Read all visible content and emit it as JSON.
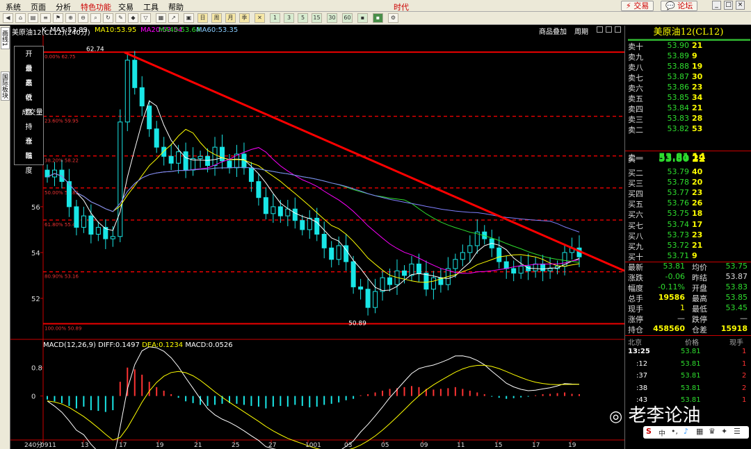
{
  "menubar": {
    "items": [
      "系统",
      "页面",
      "分析",
      "特色功能",
      "交易",
      "工具",
      "帮助"
    ],
    "title": "时代",
    "trade_button": "交易",
    "forum_button": "论坛"
  },
  "toolbar": {
    "periods": [
      "1",
      "3",
      "5",
      "15",
      "30",
      "60"
    ]
  },
  "leftrail": {
    "tab1": "画线1",
    "tab2": "国际板块"
  },
  "chart_header": {
    "instrument": "美原油12(CL12)(240分)",
    "k": "K",
    "ma5": "MA5:53.89",
    "ma10": "MA10:53.95",
    "ma20": "MA20:53.54",
    "ma40": "MA40:53.64",
    "ma60": "MA60:53.35",
    "link1": "商品叠加",
    "link2": "周期"
  },
  "pricebox": [
    {
      "a": "开",
      "b": "盘"
    },
    {
      "a": "最",
      "b": "高"
    },
    {
      "a": "最",
      "b": "低"
    },
    {
      "a": "收",
      "b": "盘"
    },
    {
      "a": "成交",
      "b": "量"
    },
    {
      "a": "持",
      "b": "仓"
    },
    {
      "a": "涨",
      "b": "跌"
    },
    {
      "a": "幅",
      "b": "度"
    }
  ],
  "chart_data": {
    "type": "candlestick",
    "timeframe": "240分",
    "ylim": [
      50.3,
      63.3
    ],
    "y_ticks": [
      52,
      54,
      56
    ],
    "x_ticks": [
      "0911",
      "13",
      "17",
      "19",
      "21",
      "25",
      "27",
      "1001",
      "03",
      "05",
      "09",
      "11",
      "15",
      "17",
      "19"
    ],
    "peak_label": "62.74",
    "low_label": "50.89",
    "fib_levels": [
      {
        "label": "0.00% 62.75",
        "value": 62.75
      },
      {
        "label": "23.60% 59.95",
        "value": 59.95
      },
      {
        "label": "38.20% 58.22",
        "value": 58.22
      },
      {
        "label": "50.00% 56.82",
        "value": 56.82
      },
      {
        "label": "61.80% 55.42",
        "value": 55.42
      },
      {
        "label": "80.90% 53.16",
        "value": 53.16
      },
      {
        "label": "100.00% 50.89",
        "value": 50.89
      }
    ],
    "trendline": {
      "from": [
        0.14,
        62.74
      ],
      "to": [
        1.0,
        53.2
      ]
    },
    "closes": [
      57.3,
      57.6,
      57.1,
      56.0,
      55.1,
      55.6,
      54.8,
      55.1,
      54.6,
      54.7,
      59.7,
      62.4,
      61.2,
      60.4,
      59.4,
      58.6,
      58.2,
      57.9,
      58.4,
      57.6,
      58.1,
      58.2,
      57.8,
      58.6,
      58.0,
      57.7,
      58.3,
      57.7,
      57.1,
      56.4,
      55.7,
      56.0,
      55.6,
      55.9,
      55.4,
      55.0,
      55.5,
      54.8,
      54.2,
      53.7,
      54.3,
      53.6,
      52.5,
      52.4,
      51.6,
      52.3,
      52.9,
      52.6,
      53.2,
      53.0,
      53.5,
      53.1,
      52.4,
      52.9,
      52.6,
      53.3,
      53.7,
      54.0,
      54.3,
      54.9,
      54.6,
      54.2,
      53.6,
      53.3,
      53.1,
      53.4,
      53.2,
      53.5,
      53.2,
      53.3,
      53.4,
      54.0,
      54.2,
      53.81
    ],
    "macd": {
      "label": "MACD(12,26,9)",
      "diff": "DIFF:0.1497",
      "dea": "DEA:0.1234",
      "macd": "MACD:0.0526",
      "ylim": [
        -1.2,
        1.4
      ],
      "y_ticks": [
        0,
        0.8
      ],
      "hist": [
        -0.1,
        -0.15,
        -0.2,
        -0.28,
        -0.35,
        -0.3,
        -0.4,
        -0.42,
        -0.45,
        -0.4,
        0.4,
        0.8,
        0.75,
        0.6,
        0.4,
        0.25,
        0.15,
        0.05,
        -0.05,
        -0.15,
        -0.2,
        -0.25,
        -0.28,
        -0.25,
        -0.22,
        -0.2,
        -0.22,
        -0.25,
        -0.28,
        -0.3,
        -0.35,
        -0.3,
        -0.28,
        -0.3,
        -0.25,
        -0.28,
        -0.32,
        -0.3,
        -0.25,
        -0.22,
        -0.18,
        -0.12,
        -0.08,
        0.02,
        0.05,
        0.1,
        0.15,
        0.2,
        0.22,
        0.25,
        0.28,
        0.25,
        0.2,
        0.18,
        0.2,
        0.22,
        0.25,
        0.2,
        0.15,
        0.1,
        0.05,
        -0.02,
        -0.05,
        -0.08,
        -0.06,
        -0.04,
        -0.02,
        0.02,
        0.05,
        0.06,
        0.08,
        0.1,
        0.06,
        0.05
      ]
    }
  },
  "panel": {
    "title": "美原油12(CL12)",
    "sell": [
      {
        "label": "卖十",
        "price": "53.90",
        "vol": "21"
      },
      {
        "label": "卖九",
        "price": "53.89",
        "vol": "9"
      },
      {
        "label": "卖八",
        "price": "53.88",
        "vol": "19"
      },
      {
        "label": "卖七",
        "price": "53.87",
        "vol": "30"
      },
      {
        "label": "卖六",
        "price": "53.86",
        "vol": "23"
      },
      {
        "label": "卖五",
        "price": "53.85",
        "vol": "34"
      },
      {
        "label": "卖四",
        "price": "53.84",
        "vol": "21"
      },
      {
        "label": "卖三",
        "price": "53.83",
        "vol": "28"
      },
      {
        "label": "卖二",
        "price": "53.82",
        "vol": "53"
      },
      {
        "label": "卖一",
        "price": "53.81",
        "vol": "14"
      }
    ],
    "buy": [
      {
        "label": "买一",
        "price": "53.80",
        "vol": "22"
      },
      {
        "label": "买二",
        "price": "53.79",
        "vol": "40"
      },
      {
        "label": "买三",
        "price": "53.78",
        "vol": "20"
      },
      {
        "label": "买四",
        "price": "53.77",
        "vol": "23"
      },
      {
        "label": "买五",
        "price": "53.76",
        "vol": "26"
      },
      {
        "label": "买六",
        "price": "53.75",
        "vol": "18"
      },
      {
        "label": "买七",
        "price": "53.74",
        "vol": "17"
      },
      {
        "label": "买八",
        "price": "53.73",
        "vol": "23"
      },
      {
        "label": "买九",
        "price": "53.72",
        "vol": "21"
      },
      {
        "label": "买十",
        "price": "53.71",
        "vol": "9"
      }
    ],
    "stats": [
      {
        "l1": "最新",
        "v1": "53.81",
        "l2": "均价",
        "v2": "53.75"
      },
      {
        "l1": "涨跌",
        "v1": "-0.06",
        "l2": "昨结",
        "v2": "53.87"
      },
      {
        "l1": "幅度",
        "v1": "-0.11%",
        "l2": "开盘",
        "v2": "53.83"
      },
      {
        "l1": "总手",
        "v1": "19586",
        "l2": "最高",
        "v2": "53.85"
      },
      {
        "l1": "现手",
        "v1": "1",
        "l2": "最低",
        "v2": "53.45"
      },
      {
        "l1": "涨停",
        "v1": "—",
        "l2": "跌停",
        "v2": "—"
      },
      {
        "l1": "持仓",
        "v1": "458560",
        "l2": "仓差",
        "v2": "15918"
      }
    ],
    "ticks_header": {
      "c1": "北京",
      "c2": "价格",
      "c3": "现手"
    },
    "ticks": [
      {
        "t": "13:25",
        "p": "53.81",
        "q": "1"
      },
      {
        "t": ":12",
        "p": "53.81",
        "q": "1"
      },
      {
        "t": ":37",
        "p": "53.81",
        "q": "2"
      },
      {
        "t": ":38",
        "p": "53.81",
        "q": "2"
      },
      {
        "t": ":43",
        "p": "53.81",
        "q": "1"
      }
    ]
  },
  "watermark": "老李论油",
  "bottom_label": "240分"
}
